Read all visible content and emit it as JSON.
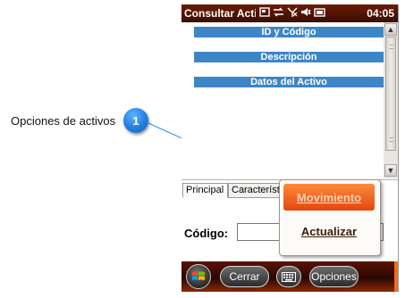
{
  "callout": {
    "label": "Opciones de activos",
    "badge": "1"
  },
  "titlebar": {
    "title": "Consultar Activo",
    "time": "04:05",
    "icons": [
      "window-icon",
      "sync-arrows-icon",
      "no-signal-icon",
      "speaker-mute-icon",
      "battery-icon"
    ]
  },
  "sections": [
    "ID y Código",
    "Descripción",
    "Datos del Activo"
  ],
  "tabs": {
    "principal": "Principal",
    "caracteristicas": "Característ"
  },
  "form": {
    "code_label": "Código:",
    "code_value": ""
  },
  "popup_menu": {
    "items": [
      "Movimiento",
      "Actualizar"
    ]
  },
  "softbar": {
    "left": "Cerrar",
    "right": "Opciones"
  },
  "colors": {
    "titlebar": "#3a0c02",
    "section_bar": "#3d86c6",
    "menu_highlight": "#e3470d",
    "callout_badge": "#1f7fe0"
  }
}
